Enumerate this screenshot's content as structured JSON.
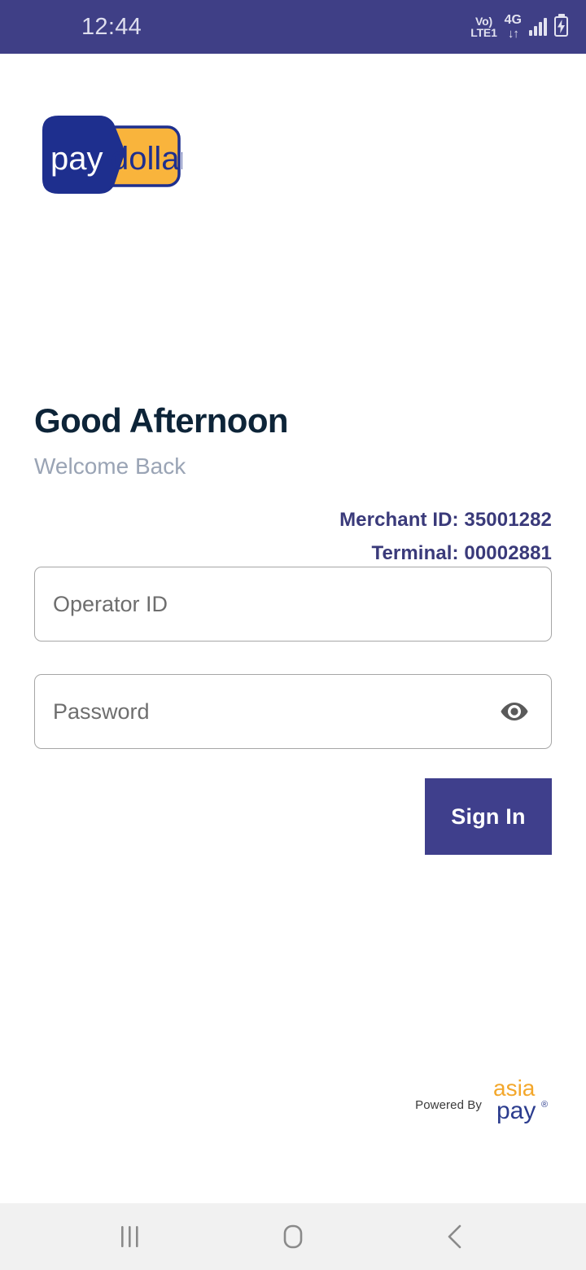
{
  "status_bar": {
    "time": "12:44",
    "volte_top": "Vo)",
    "volte_bottom": "LTE1",
    "network_type": "4G",
    "data_arrows": "↓↑",
    "signal_icon": "signal-bars-icon",
    "battery_icon": "battery-charging-icon",
    "background_color": "#3F3F86",
    "text_color": "#DDDDEE"
  },
  "brand": {
    "logo_name": "paydollar-logo",
    "part_one": "pay",
    "part_two": "dollar",
    "blue_color": "#1E2F8E",
    "amber_color": "#F9B43C"
  },
  "greeting": {
    "title": "Good Afternoon",
    "subtitle": "Welcome Back",
    "title_color": "#0D2438",
    "subtitle_color": "#9AA4B5"
  },
  "merchant": {
    "merchant_line": "Merchant ID: 35001282",
    "terminal_line": "Terminal: 00002881",
    "text_color": "#3A3A7A"
  },
  "form": {
    "operator_id": {
      "placeholder": "Operator ID",
      "value": ""
    },
    "password": {
      "placeholder": "Password",
      "value": "",
      "toggle_icon": "eye-visibility-icon"
    },
    "sign_in_label": "Sign In",
    "sign_in_color": "#3F3F8C"
  },
  "footer": {
    "powered_by": "Powered By",
    "brand_top": "asia",
    "brand_bottom": "pay",
    "registered_mark": "®",
    "asia_color": "#F3A72B",
    "pay_color": "#2B3C8E"
  },
  "nav_bar": {
    "recents_icon": "recents-icon",
    "home_icon": "home-icon",
    "back_icon": "back-chevron-icon",
    "background_color": "#F1F1F1",
    "icon_color": "#8A8A8A"
  }
}
